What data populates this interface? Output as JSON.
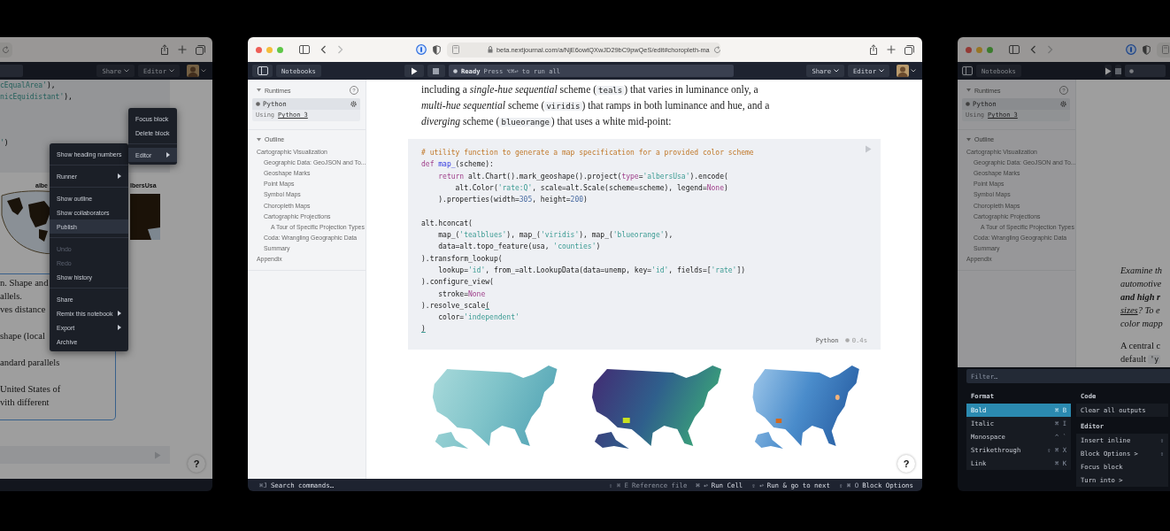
{
  "left_window": {
    "toolbar": {
      "share": "Share",
      "editor": "Editor"
    },
    "code_lines": [
      [
        {
          "kind": "string",
          "text": "cEqualArea'"
        },
        {
          "kind": "plain",
          "text": "),"
        }
      ],
      [
        {
          "kind": "string",
          "text": "nicEquidistant'"
        },
        {
          "kind": "plain",
          "text": "),"
        }
      ],
      [
        {
          "kind": "string",
          "text": "'"
        },
        {
          "kind": "plain",
          "text": ")"
        }
      ]
    ],
    "chart_titles": [
      "albe",
      "lbersUsa"
    ],
    "paragraphs": [
      [
        "n. Shape and",
        "allels.",
        "ves distance"
      ],
      [
        "shape (local"
      ],
      [
        "andard parallels"
      ],
      [
        "United States of",
        "vith different"
      ]
    ],
    "help": "?",
    "menu": [
      {
        "kind": "item",
        "label": "Show heading numbers",
        "selected": false,
        "disabled": false,
        "submenu": false
      },
      {
        "kind": "separator"
      },
      {
        "kind": "item",
        "label": "Runner",
        "selected": false,
        "disabled": false,
        "submenu": true
      },
      {
        "kind": "separator"
      },
      {
        "kind": "item",
        "label": "Show outline",
        "selected": false,
        "disabled": false,
        "submenu": false
      },
      {
        "kind": "item",
        "label": "Show collaborators",
        "selected": false,
        "disabled": false,
        "submenu": false
      },
      {
        "kind": "item",
        "label": "Publish",
        "selected": true,
        "disabled": false,
        "submenu": false
      },
      {
        "kind": "separator"
      },
      {
        "kind": "item",
        "label": "Undo",
        "selected": false,
        "disabled": true,
        "submenu": false
      },
      {
        "kind": "item",
        "label": "Redo",
        "selected": false,
        "disabled": true,
        "submenu": false
      },
      {
        "kind": "item",
        "label": "Show history",
        "selected": false,
        "disabled": false,
        "submenu": false
      },
      {
        "kind": "separator"
      },
      {
        "kind": "item",
        "label": "Share",
        "selected": false,
        "disabled": false,
        "submenu": false
      },
      {
        "kind": "item",
        "label": "Remix this notebook",
        "selected": false,
        "disabled": false,
        "submenu": true
      },
      {
        "kind": "item",
        "label": "Export",
        "selected": false,
        "disabled": false,
        "submenu": true
      },
      {
        "kind": "item",
        "label": "Archive",
        "selected": false,
        "disabled": false,
        "submenu": false
      }
    ],
    "submenu": [
      {
        "kind": "item",
        "label": "Focus block",
        "selected": false,
        "disabled": false,
        "submenu": false
      },
      {
        "kind": "item",
        "label": "Delete block",
        "selected": false,
        "disabled": false,
        "submenu": false
      },
      {
        "kind": "separator"
      },
      {
        "kind": "item",
        "label": "Editor",
        "selected": true,
        "disabled": false,
        "submenu": true
      }
    ]
  },
  "center_window": {
    "address_bar": {
      "url": "beta.nextjournal.com/a/NjE6owtQXwJD29bC9pwQeS/edit#choropleth-ma"
    },
    "toolbar": {
      "notebooks": "Notebooks",
      "status": "Ready",
      "hint": "Press ⌥⌘↩ to run all",
      "share": "Share",
      "editor": "Editor"
    },
    "sidebar": {
      "runtimes_title": "Runtimes",
      "help": "?",
      "runtime": {
        "name": "Python",
        "using": "Using",
        "version": "Python 3"
      },
      "outline_title": "Outline",
      "outline": [
        {
          "label": "Cartographic Visualization",
          "children": [
            {
              "label": "Geographic Data: GeoJSON and To..."
            },
            {
              "label": "Geoshape Marks"
            },
            {
              "label": "Point Maps"
            },
            {
              "label": "Symbol Maps"
            },
            {
              "label": "Choropleth Maps"
            },
            {
              "label": "Cartographic Projections",
              "children": [
                {
                  "label": "A Tour of Specific Projection Types"
                }
              ]
            },
            {
              "label": "Coda: Wrangling Geographic Data"
            },
            {
              "label": "Summary"
            }
          ]
        },
        {
          "label": "Appendix"
        }
      ]
    },
    "paragraph": [
      [
        {
          "kind": "text",
          "text": "including a "
        },
        {
          "kind": "em",
          "text": "single-hue sequential"
        },
        {
          "kind": "text",
          "text": " scheme ("
        },
        {
          "kind": "code",
          "text": "teals"
        },
        {
          "kind": "text",
          "text": ") that varies in luminance only, a"
        }
      ],
      [
        {
          "kind": "em",
          "text": "multi-hue sequential"
        },
        {
          "kind": "text",
          "text": " scheme ("
        },
        {
          "kind": "code",
          "text": "viridis"
        },
        {
          "kind": "text",
          "text": ") that ramps in both luminance and hue, and a"
        }
      ],
      [
        {
          "kind": "em",
          "text": "diverging"
        },
        {
          "kind": "text",
          "text": " scheme ("
        },
        {
          "kind": "code",
          "text": "blueorange"
        },
        {
          "kind": "text",
          "text": ") that uses a white mid-point:"
        }
      ]
    ],
    "code_cell": {
      "blocks": [
        [
          [
            {
              "kind": "comment",
              "text": "# utility function to generate a map specification for a provided color scheme"
            }
          ],
          [
            {
              "kind": "keyword",
              "text": "def"
            },
            {
              "kind": "function",
              "text": " map_"
            },
            {
              "kind": "plain",
              "text": "(scheme):"
            }
          ],
          [
            {
              "kind": "keyword",
              "text": "    return"
            },
            {
              "kind": "plain",
              "text": " alt.Chart().mark_geoshape().project("
            },
            {
              "kind": "keyword",
              "text": "type"
            },
            {
              "kind": "plain",
              "text": "="
            },
            {
              "kind": "string",
              "text": "'albersUsa'"
            },
            {
              "kind": "plain",
              "text": ").encode("
            }
          ],
          [
            {
              "kind": "plain",
              "text": "        alt.Color("
            },
            {
              "kind": "string",
              "text": "'rate:Q'"
            },
            {
              "kind": "plain",
              "text": ", scale=alt.Scale(scheme=scheme), legend="
            },
            {
              "kind": "keyword",
              "text": "None"
            },
            {
              "kind": "plain",
              "text": ")"
            }
          ],
          [
            {
              "kind": "plain",
              "text": "    ).properties(width="
            },
            {
              "kind": "number",
              "text": "305"
            },
            {
              "kind": "plain",
              "text": ", height="
            },
            {
              "kind": "number",
              "text": "200"
            },
            {
              "kind": "plain",
              "text": ")"
            }
          ]
        ],
        [
          [
            {
              "kind": "plain",
              "text": "alt.hconcat("
            }
          ],
          [
            {
              "kind": "plain",
              "text": "    map_("
            },
            {
              "kind": "string",
              "text": "'tealblues'"
            },
            {
              "kind": "plain",
              "text": "), map_("
            },
            {
              "kind": "string",
              "text": "'viridis'"
            },
            {
              "kind": "plain",
              "text": "), map_("
            },
            {
              "kind": "string",
              "text": "'blueorange'"
            },
            {
              "kind": "plain",
              "text": "),"
            }
          ],
          [
            {
              "kind": "plain",
              "text": "    data=alt.topo_feature(usa, "
            },
            {
              "kind": "string",
              "text": "'counties'"
            },
            {
              "kind": "plain",
              "text": ")"
            }
          ],
          [
            {
              "kind": "plain",
              "text": ").transform_lookup("
            }
          ],
          [
            {
              "kind": "plain",
              "text": "    lookup="
            },
            {
              "kind": "string",
              "text": "'id'"
            },
            {
              "kind": "plain",
              "text": ", from_=alt.LookupData(data=unemp, key="
            },
            {
              "kind": "string",
              "text": "'id'"
            },
            {
              "kind": "plain",
              "text": ", fields=["
            },
            {
              "kind": "string",
              "text": "'rate'"
            },
            {
              "kind": "plain",
              "text": "])"
            }
          ],
          [
            {
              "kind": "plain",
              "text": ").configure_view("
            }
          ],
          [
            {
              "kind": "plain",
              "text": "    stroke="
            },
            {
              "kind": "keyword",
              "text": "None"
            }
          ],
          [
            {
              "kind": "plain",
              "text": ").resolve_scale"
            },
            {
              "kind": "bracket",
              "text": "("
            }
          ],
          [
            {
              "kind": "plain",
              "text": "    color="
            },
            {
              "kind": "string",
              "text": "'independent'"
            }
          ],
          [
            {
              "kind": "bracket",
              "text": ")"
            }
          ]
        ]
      ],
      "language": "Python",
      "duration": "0.4s"
    },
    "help": "?",
    "status_bar": {
      "search": {
        "keys": "⌘J",
        "label": "Search commands…"
      },
      "actions": [
        {
          "keys": "⇧ ⌘ E",
          "label": "Reference file",
          "disabled": true
        },
        {
          "keys": "⌘ ↩",
          "label": "Run Cell",
          "disabled": false
        },
        {
          "keys": "⇧ ↩",
          "label": "Run & go to next",
          "disabled": false
        },
        {
          "keys": "⇧ ⌘ O",
          "label": "Block Options",
          "disabled": false
        }
      ]
    }
  },
  "right_window": {
    "toolbar": {
      "notebooks": "Notebooks"
    },
    "sidebar": {
      "runtimes_title": "Runtimes",
      "help": "?",
      "runtime": {
        "name": "Python",
        "using": "Using",
        "version": "Python 3"
      },
      "outline_title": "Outline",
      "outline": [
        {
          "label": "Cartographic Visualization",
          "children": [
            {
              "label": "Geographic Data: GeoJSON and To..."
            },
            {
              "label": "Geoshape Marks"
            },
            {
              "label": "Point Maps"
            },
            {
              "label": "Symbol Maps"
            },
            {
              "label": "Choropleth Maps"
            },
            {
              "label": "Cartographic Projections",
              "children": [
                {
                  "label": "A Tour of Specific Projection Types"
                }
              ]
            },
            {
              "label": "Coda: Wrangling Geographic Data"
            },
            {
              "label": "Summary"
            }
          ]
        },
        {
          "label": "Appendix"
        }
      ]
    },
    "paragraphs": [
      [
        [
          {
            "kind": "em",
            "text": "Examine th"
          }
        ],
        [
          {
            "kind": "em",
            "text": "automotive"
          }
        ],
        [
          {
            "kind": "strong_em",
            "text": "and high r"
          }
        ],
        [
          {
            "kind": "em_link",
            "text": "sizes"
          },
          {
            "kind": "em",
            "text": "? To e"
          }
        ],
        [
          {
            "kind": "em",
            "text": "color mapp"
          }
        ]
      ],
      [
        [
          {
            "kind": "text",
            "text": "A central c"
          }
        ],
        [
          {
            "kind": "text",
            "text": "default "
          },
          {
            "kind": "code",
            "text": "'y"
          }
        ]
      ]
    ],
    "palette": {
      "placeholder": "Filter…",
      "format_title": "Format",
      "format_items": [
        {
          "label": "Bold",
          "keys": "⌘ B",
          "selected": true
        },
        {
          "label": "Italic",
          "keys": "⌘ I",
          "selected": false
        },
        {
          "label": "Monospace",
          "keys": "^ `",
          "selected": false
        },
        {
          "label": "Strikethrough",
          "keys": "⇧ ⌘ X",
          "selected": false
        },
        {
          "label": "Link",
          "keys": "⌘ K",
          "selected": false
        }
      ],
      "code_title": "Code",
      "code_items": [
        {
          "label": "Clear all outputs"
        }
      ],
      "editor_title": "Editor",
      "editor_items": [
        {
          "label": "Insert inline",
          "keys": "⇧"
        },
        {
          "label": "Block Options >",
          "keys": "⇧"
        },
        {
          "label": "Focus block"
        },
        {
          "label": "Turn into >"
        }
      ]
    }
  }
}
